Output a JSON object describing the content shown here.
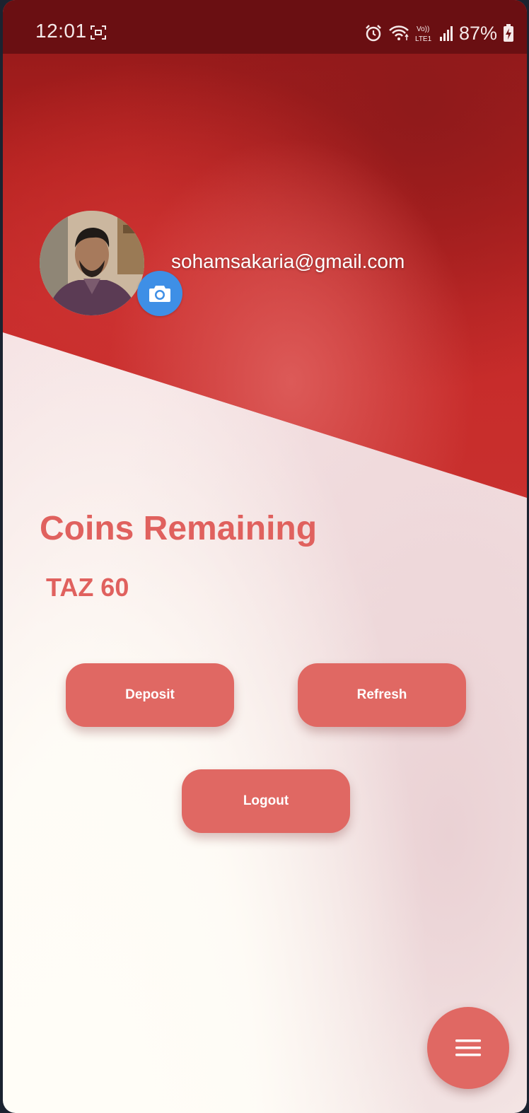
{
  "status_bar": {
    "time": "12:01",
    "battery": "87%",
    "network_label": "Vo) LTE1",
    "icons": [
      "screenshot-icon",
      "alarm-icon",
      "wifi-icon",
      "volte-icon",
      "signal-icon",
      "battery-charging-icon"
    ]
  },
  "profile": {
    "email": "sohamsakaria@gmail.com",
    "avatar_icon": "user-photo",
    "camera_icon": "camera-icon"
  },
  "coins": {
    "title": "Coins Remaining",
    "value": "TAZ 60"
  },
  "buttons": {
    "deposit": "Deposit",
    "refresh": "Refresh",
    "logout": "Logout"
  },
  "fab": {
    "icon": "menu-icon"
  },
  "colors": {
    "header_red": "#c62a29",
    "status_bar": "#6a0f12",
    "accent": "#e06863",
    "camera_blue": "#3e8fe6"
  }
}
